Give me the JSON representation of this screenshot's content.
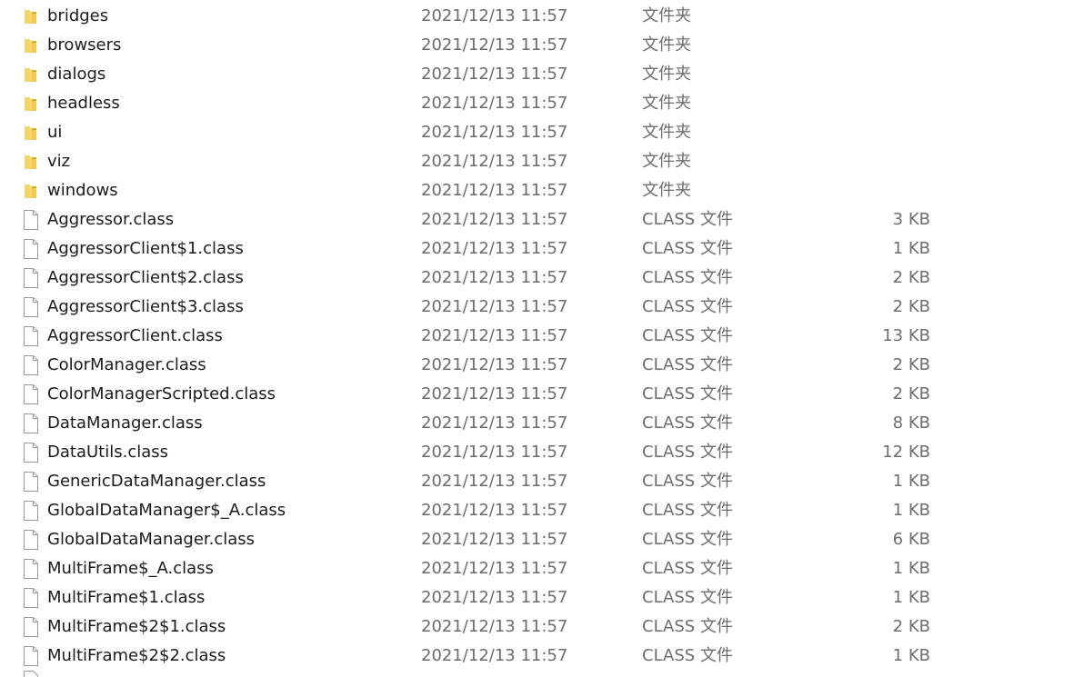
{
  "icons": {
    "folder": "folder-icon",
    "file": "file-icon"
  },
  "colors": {
    "folder": "#f2c94c",
    "folder_dark": "#e0ae2a",
    "file_outline": "#9a9a9a",
    "secondary_text": "#6d6d6d"
  },
  "files": [
    {
      "kind": "folder",
      "name": "bridges",
      "date": "2021/12/13 11:57",
      "type": "文件夹",
      "size": ""
    },
    {
      "kind": "folder",
      "name": "browsers",
      "date": "2021/12/13 11:57",
      "type": "文件夹",
      "size": ""
    },
    {
      "kind": "folder",
      "name": "dialogs",
      "date": "2021/12/13 11:57",
      "type": "文件夹",
      "size": ""
    },
    {
      "kind": "folder",
      "name": "headless",
      "date": "2021/12/13 11:57",
      "type": "文件夹",
      "size": ""
    },
    {
      "kind": "folder",
      "name": "ui",
      "date": "2021/12/13 11:57",
      "type": "文件夹",
      "size": ""
    },
    {
      "kind": "folder",
      "name": "viz",
      "date": "2021/12/13 11:57",
      "type": "文件夹",
      "size": ""
    },
    {
      "kind": "folder",
      "name": "windows",
      "date": "2021/12/13 11:57",
      "type": "文件夹",
      "size": ""
    },
    {
      "kind": "file",
      "name": "Aggressor.class",
      "date": "2021/12/13 11:57",
      "type": "CLASS 文件",
      "size": "3 KB"
    },
    {
      "kind": "file",
      "name": "AggressorClient$1.class",
      "date": "2021/12/13 11:57",
      "type": "CLASS 文件",
      "size": "1 KB"
    },
    {
      "kind": "file",
      "name": "AggressorClient$2.class",
      "date": "2021/12/13 11:57",
      "type": "CLASS 文件",
      "size": "2 KB"
    },
    {
      "kind": "file",
      "name": "AggressorClient$3.class",
      "date": "2021/12/13 11:57",
      "type": "CLASS 文件",
      "size": "2 KB"
    },
    {
      "kind": "file",
      "name": "AggressorClient.class",
      "date": "2021/12/13 11:57",
      "type": "CLASS 文件",
      "size": "13 KB"
    },
    {
      "kind": "file",
      "name": "ColorManager.class",
      "date": "2021/12/13 11:57",
      "type": "CLASS 文件",
      "size": "2 KB"
    },
    {
      "kind": "file",
      "name": "ColorManagerScripted.class",
      "date": "2021/12/13 11:57",
      "type": "CLASS 文件",
      "size": "2 KB"
    },
    {
      "kind": "file",
      "name": "DataManager.class",
      "date": "2021/12/13 11:57",
      "type": "CLASS 文件",
      "size": "8 KB"
    },
    {
      "kind": "file",
      "name": "DataUtils.class",
      "date": "2021/12/13 11:57",
      "type": "CLASS 文件",
      "size": "12 KB"
    },
    {
      "kind": "file",
      "name": "GenericDataManager.class",
      "date": "2021/12/13 11:57",
      "type": "CLASS 文件",
      "size": "1 KB"
    },
    {
      "kind": "file",
      "name": "GlobalDataManager$_A.class",
      "date": "2021/12/13 11:57",
      "type": "CLASS 文件",
      "size": "1 KB"
    },
    {
      "kind": "file",
      "name": "GlobalDataManager.class",
      "date": "2021/12/13 11:57",
      "type": "CLASS 文件",
      "size": "6 KB"
    },
    {
      "kind": "file",
      "name": "MultiFrame$_A.class",
      "date": "2021/12/13 11:57",
      "type": "CLASS 文件",
      "size": "1 KB"
    },
    {
      "kind": "file",
      "name": "MultiFrame$1.class",
      "date": "2021/12/13 11:57",
      "type": "CLASS 文件",
      "size": "1 KB"
    },
    {
      "kind": "file",
      "name": "MultiFrame$2$1.class",
      "date": "2021/12/13 11:57",
      "type": "CLASS 文件",
      "size": "2 KB"
    },
    {
      "kind": "file",
      "name": "MultiFrame$2$2.class",
      "date": "2021/12/13 11:57",
      "type": "CLASS 文件",
      "size": "1 KB"
    }
  ]
}
